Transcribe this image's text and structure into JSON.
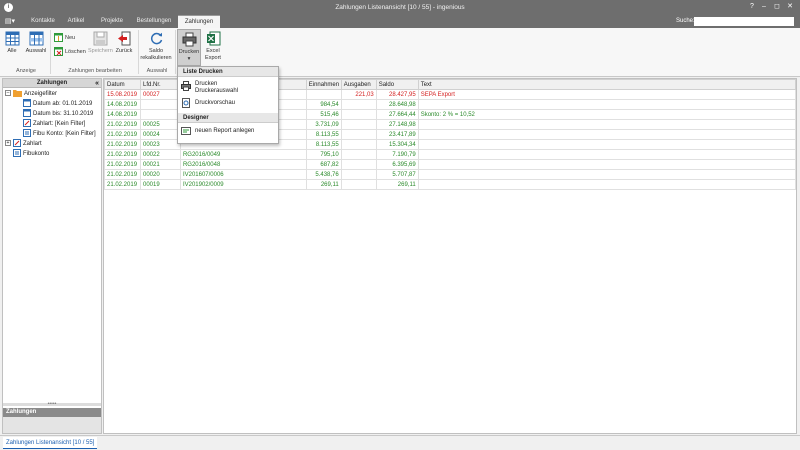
{
  "window": {
    "title": "Zahlungen Listenansicht [10 / 55] - ingenious"
  },
  "menu": {
    "tabs": [
      "Kontakte",
      "Artikel",
      "Projekte",
      "Bestellungen",
      "Zahlungen"
    ],
    "active_tab": "Zahlungen",
    "search_label": "Suche:",
    "search_value": ""
  },
  "ribbon": {
    "anzeige": {
      "alle": "Alle",
      "auswahl": "Auswahl",
      "group": "Anzeige"
    },
    "bearbeiten": {
      "neu": "Neu",
      "loeschen": "Löschen",
      "speichern": "Speichern",
      "zurueck": "Zurück",
      "group": "Zahlungen bearbeiten"
    },
    "auswahl": {
      "saldo_line1": "Saldo",
      "saldo_line2": "rekalkulieren",
      "group": "Auswahl"
    },
    "drucken": "Drucken",
    "excel_line1": "Excel",
    "excel_line2": "Export"
  },
  "left_panel": {
    "title": "Zahlungen",
    "anzeigefilter": "Anzeigefilter",
    "filters": [
      "Datum ab: 01.01.2019",
      "Datum bis: 31.10.2019",
      "Zahlart: [Kein Filter]",
      "Fibu Konto: [Kein Filter]"
    ],
    "zahlart": "Zahlart",
    "fibukonto": "Fibukonto",
    "bottom_title": "Zahlungen"
  },
  "dropdown": {
    "section1": "Liste Drucken",
    "item1_line1": "Drucken",
    "item1_line2": "Druckerauswahl",
    "item2": "Druckvorschau",
    "section2": "Designer",
    "item3": "neuen Report anlegen"
  },
  "table": {
    "columns": [
      "Datum",
      "Lfd.Nr.",
      "",
      "Einnahmen",
      "Ausgaben",
      "Saldo",
      "Text"
    ],
    "rows": [
      {
        "datum": "15.08.2019",
        "lfdnr": "00027",
        "beleg": "",
        "einnahmen": "",
        "ausgaben": "221,03",
        "saldo": "28.427,95",
        "text": "SEPA Export",
        "color": "red"
      },
      {
        "datum": "14.08.2019",
        "lfdnr": "",
        "beleg": "",
        "einnahmen": "984,54",
        "ausgaben": "",
        "saldo": "28.648,98",
        "text": "",
        "color": "green"
      },
      {
        "datum": "14.08.2019",
        "lfdnr": "",
        "beleg": "",
        "einnahmen": "515,46",
        "ausgaben": "",
        "saldo": "27.664,44",
        "text": "Skonto: 2 % = 10,52",
        "color": "green"
      },
      {
        "datum": "21.02.2019",
        "lfdnr": "00025",
        "beleg": "",
        "einnahmen": "3.731,09",
        "ausgaben": "",
        "saldo": "27.148,98",
        "text": "",
        "color": "green"
      },
      {
        "datum": "21.02.2019",
        "lfdnr": "00024",
        "beleg": "",
        "einnahmen": "8.113,55",
        "ausgaben": "",
        "saldo": "23.417,89",
        "text": "",
        "color": "green"
      },
      {
        "datum": "21.02.2019",
        "lfdnr": "00023",
        "beleg": "",
        "einnahmen": "8.113,55",
        "ausgaben": "",
        "saldo": "15.304,34",
        "text": "",
        "color": "green"
      },
      {
        "datum": "21.02.2019",
        "lfdnr": "00022",
        "beleg": "RG2016/0049",
        "einnahmen": "795,10",
        "ausgaben": "",
        "saldo": "7.190,79",
        "text": "",
        "color": "green"
      },
      {
        "datum": "21.02.2019",
        "lfdnr": "00021",
        "beleg": "RG2016/0048",
        "einnahmen": "687,82",
        "ausgaben": "",
        "saldo": "6.395,69",
        "text": "",
        "color": "green"
      },
      {
        "datum": "21.02.2019",
        "lfdnr": "00020",
        "beleg": "IV201607/0006",
        "einnahmen": "5.438,76",
        "ausgaben": "",
        "saldo": "5.707,87",
        "text": "",
        "color": "green"
      },
      {
        "datum": "21.02.2019",
        "lfdnr": "00019",
        "beleg": "IV201902/0009",
        "einnahmen": "269,11",
        "ausgaben": "",
        "saldo": "269,11",
        "text": "",
        "color": "green"
      }
    ]
  },
  "statusbar": {
    "tab": "Zahlungen Listenansicht [10 / 55]"
  },
  "colors": {
    "titlebar": "#6e6e6e",
    "negative": "#d42020",
    "positive": "#2a8a2a",
    "accent": "#1c5fb0"
  }
}
